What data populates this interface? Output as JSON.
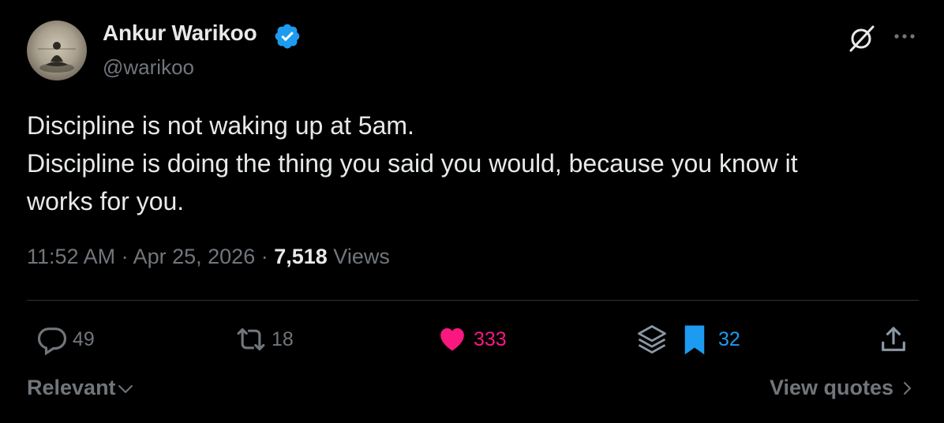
{
  "author": {
    "display_name": "Ankur Warikoo",
    "handle": "@warikoo",
    "avatar_icon": "meditating-figure-avatar",
    "verified_icon": "verified-badge-icon",
    "verified_color": "#1d9bf0"
  },
  "header_actions": {
    "grok_icon": "grok-icon",
    "more_icon": "more-icon"
  },
  "tweet": {
    "lines": [
      "Discipline is not waking up at 5am.",
      "Discipline is doing the thing you said you would, because you know it",
      "works for you."
    ]
  },
  "meta": {
    "time": "11:52 AM",
    "separator": " · ",
    "date": "Apr 25, 2026",
    "views_count": "7,518",
    "views_label": " Views"
  },
  "actions": {
    "replies": "49",
    "reposts": "18",
    "likes": "333",
    "bookmarks": "32",
    "like_color": "#f91880",
    "bookmark_color": "#1d9bf0",
    "muted_color": "#71767b"
  },
  "footer": {
    "sort_label": "Relevant",
    "view_quotes_label": "View quotes"
  }
}
